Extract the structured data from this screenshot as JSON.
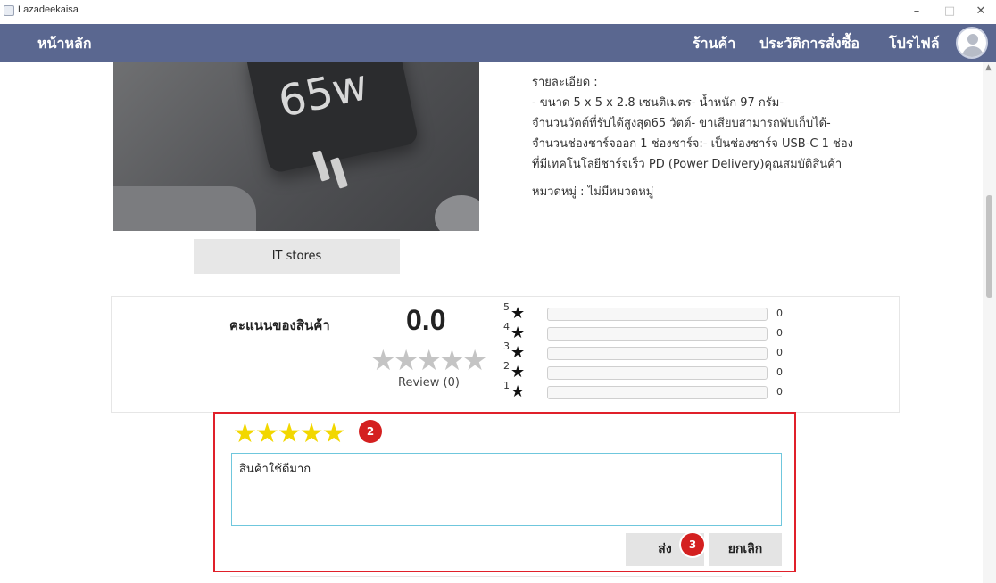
{
  "window": {
    "title": "Lazadeekaisa",
    "minimize": "–",
    "maximize": "□",
    "close": "✕"
  },
  "nav": {
    "home": "หน้าหลัก",
    "shop": "ร้านค้า",
    "history": "ประวัติการสั่งซื้อ",
    "profile": "โปรไฟล์"
  },
  "product": {
    "image_text": "65w",
    "store_button": "IT stores",
    "description": {
      "heading": "รายละเอียด :",
      "lines": [
        "- ขนาด 5 x 5 x 2.8 เซนติเมตร- น้ำหนัก 97 กรัม-",
        "จำนวนวัตต์ที่รับได้สูงสุด65 วัตต์- ขาเสียบสามารถพับเก็บได้-",
        "จำนวนช่องชาร์จออก 1 ช่องชาร์จ:- เป็นช่องชาร์จ USB-C 1 ช่อง",
        "ที่มีเทคโนโลยีชาร์จเร็ว PD (Power Delivery)คุณสมบัติสินค้า"
      ],
      "category": "หมวดหมู่ : ไม่มีหมวดหมู่"
    }
  },
  "rating": {
    "label": "คะแนนของสินค้า",
    "score": "0.0",
    "stars": "★★★★★",
    "review_count": "Review (0)",
    "distribution": [
      {
        "stars": "5",
        "count": "0",
        "fraction": 0
      },
      {
        "stars": "4",
        "count": "0",
        "fraction": 0
      },
      {
        "stars": "3",
        "count": "0",
        "fraction": 0
      },
      {
        "stars": "2",
        "count": "0",
        "fraction": 0
      },
      {
        "stars": "1",
        "count": "0",
        "fraction": 0
      }
    ]
  },
  "review_form": {
    "stars": "★★★★★",
    "selected_rating": 5,
    "comment": "สินค้าใช้ดีมาก",
    "send": "ส่ง",
    "cancel": "ยกเลิก",
    "step_badges": [
      "2",
      "3"
    ]
  },
  "colors": {
    "nav": "#5a6790",
    "star_active": "#f2d700",
    "highlight_border": "#e0202a",
    "badge": "#d42020"
  }
}
